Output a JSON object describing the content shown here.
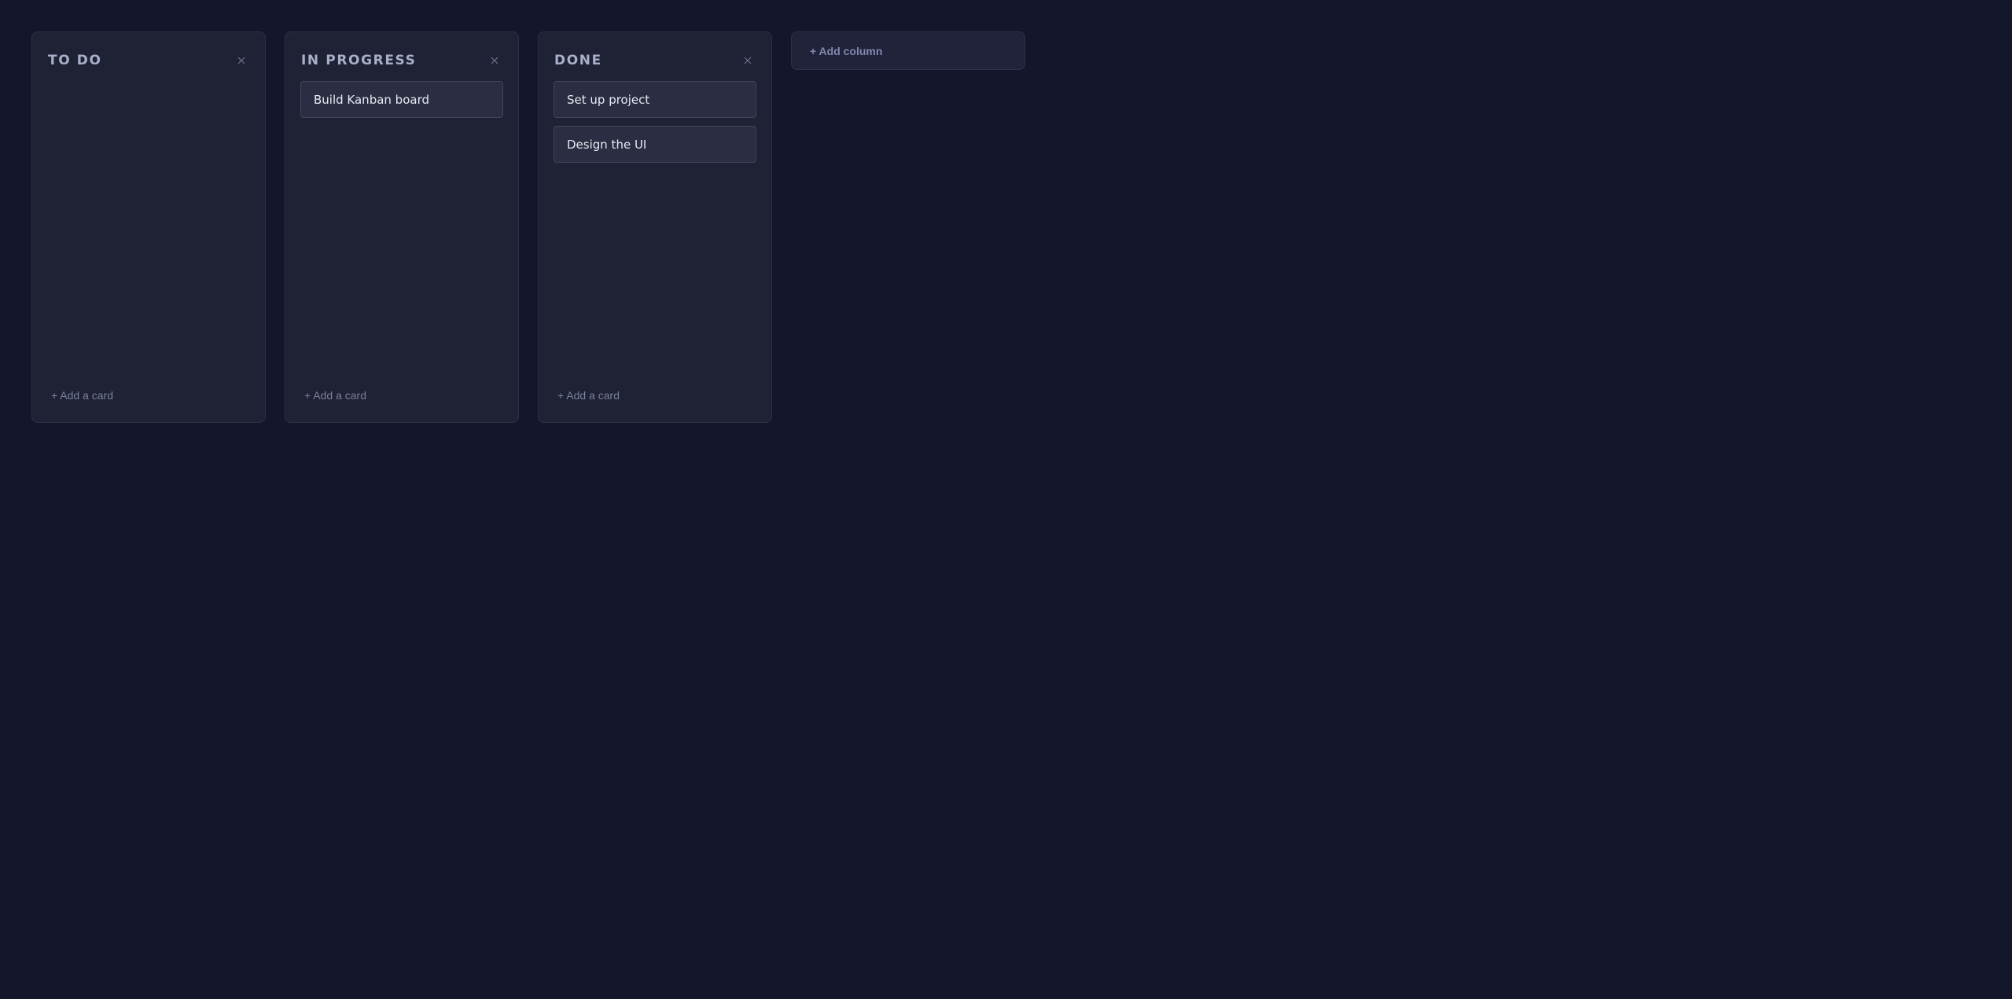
{
  "board": {
    "columns": [
      {
        "title": "TO DO",
        "close_icon": "close-icon",
        "cards": [],
        "add_card_label": "+ Add a card"
      },
      {
        "title": "IN PROGRESS",
        "close_icon": "close-icon",
        "cards": [
          "Build Kanban board"
        ],
        "add_card_label": "+ Add a card"
      },
      {
        "title": "DONE",
        "close_icon": "close-icon",
        "cards": [
          "Set up project",
          "Design the UI"
        ],
        "add_card_label": "+ Add a card"
      }
    ],
    "add_column_label": "+ Add column"
  },
  "colors": {
    "background": "#14162b",
    "column_bg": "#1f2134",
    "card_bg": "#2b2e42",
    "column_title": "#a7afcb",
    "card_text": "#e6e8f2",
    "muted_text": "#7b819d"
  }
}
